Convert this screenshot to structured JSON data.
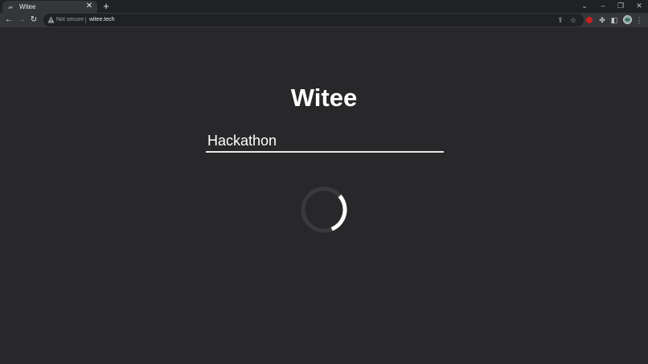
{
  "browser": {
    "tab": {
      "title": "Witee",
      "favicon": "𝓌"
    },
    "address_bar": {
      "security_label": "Not secure",
      "url": "witee.tech"
    }
  },
  "page": {
    "title": "Witee",
    "search": {
      "value": "Hackathon",
      "placeholder": ""
    },
    "loading": true
  }
}
